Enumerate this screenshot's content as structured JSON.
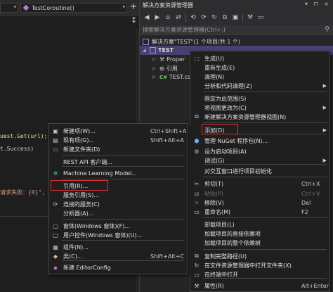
{
  "editor": {
    "nav_left": "",
    "nav_method": "TestCoroutine()",
    "add_glyph": "+",
    "split_glyph": "↕",
    "code_lines": [
      {
        "text": "uest.Get(url);",
        "color": "c-yellow"
      },
      {
        "text": "t.Success)",
        "color": "c-white"
      },
      {
        "text": "请求失败：{0}\", ...",
        "color": "c-red"
      }
    ]
  },
  "explorer": {
    "title": "解决方案资源管理器",
    "title_controls": "▾ ⊓ ×",
    "search_placeholder": "搜索解决方案资源管理器(Ctrl+;)",
    "tree": {
      "solution": "解决方案\"TEST\"(1 个项目/共 1 个)",
      "project": "TEST",
      "properties": "Proper",
      "references": "引用",
      "file": "TEST.cs"
    }
  },
  "left_menu": {
    "items": [
      {
        "label": "新建项(W)...",
        "shortcut": "Ctrl+Shift+A",
        "icon": "new-item-icon",
        "glyph": "▣",
        "color": "#c5c5c5"
      },
      {
        "label": "现有项(G)...",
        "shortcut": "Shift+Alt+A",
        "icon": "existing-item-icon",
        "glyph": "▤",
        "color": "#c5c5c5"
      },
      {
        "label": "新建文件夹(D)",
        "shortcut": "",
        "icon": "new-folder-icon",
        "glyph": "▭",
        "color": "#dcb67a"
      },
      {
        "label": "REST API 客户端...",
        "shortcut": "",
        "icon": "",
        "glyph": "",
        "color": ""
      },
      {
        "label": "Machine Learning Model...",
        "shortcut": "",
        "icon": "ml-model-icon",
        "glyph": "✲",
        "color": "#4ec9b0"
      },
      {
        "label": "引用(R)...",
        "shortcut": "",
        "icon": "",
        "glyph": "",
        "color": ""
      },
      {
        "label": "服务引用(S)...",
        "shortcut": "",
        "icon": "",
        "glyph": "",
        "color": ""
      },
      {
        "label": "连接的服务(C)",
        "shortcut": "",
        "icon": "connected-service-icon",
        "glyph": "⟳",
        "color": "#c5c5c5"
      },
      {
        "label": "分析器(A)...",
        "shortcut": "",
        "icon": "",
        "glyph": "",
        "color": ""
      },
      {
        "label": "窗体(Windows 窗体)(F)...",
        "shortcut": "",
        "icon": "form-icon",
        "glyph": "▢",
        "color": "#c5c5c5"
      },
      {
        "label": "用户控件(Windows 窗体)(U)...",
        "shortcut": "",
        "icon": "user-control-icon",
        "glyph": "▢",
        "color": "#c5c5c5"
      },
      {
        "label": "组件(N)...",
        "shortcut": "",
        "icon": "component-icon",
        "glyph": "▦",
        "color": "#c5c5c5"
      },
      {
        "label": "类(C)...",
        "shortcut": "Shift+Alt+C",
        "icon": "class-icon",
        "glyph": "◆",
        "color": "#dcb67a"
      },
      {
        "label": "新建 EditorConfig",
        "shortcut": "",
        "icon": "editorconfig-icon",
        "glyph": "▪",
        "color": "#b180d7"
      }
    ]
  },
  "right_menu": {
    "items": [
      {
        "label": "生成(U)",
        "shortcut": "",
        "icon": "build-icon",
        "glyph": "⬚",
        "color": "#c5c5c5",
        "submenu": false,
        "disabled": false
      },
      {
        "label": "重新生成(E)",
        "shortcut": "",
        "icon": "",
        "glyph": "",
        "color": "",
        "submenu": false,
        "disabled": false
      },
      {
        "label": "清理(N)",
        "shortcut": "",
        "icon": "",
        "glyph": "",
        "color": "",
        "submenu": false,
        "disabled": false
      },
      {
        "label": "分析和代码清理(Z)",
        "shortcut": "",
        "icon": "",
        "glyph": "",
        "color": "",
        "submenu": true,
        "disabled": false
      },
      {
        "label": "限定为此范围(S)",
        "shortcut": "",
        "icon": "",
        "glyph": "",
        "color": "",
        "submenu": false,
        "disabled": false
      },
      {
        "label": "将视图更改为(C)",
        "shortcut": "",
        "icon": "",
        "glyph": "",
        "color": "",
        "submenu": true,
        "disabled": false
      },
      {
        "label": "新建解决方案资源管理器视图(N)",
        "shortcut": "",
        "icon": "new-view-icon",
        "glyph": "⧉",
        "color": "#c5c5c5",
        "submenu": false,
        "disabled": false
      },
      {
        "label": "添加(D)",
        "shortcut": "",
        "icon": "",
        "glyph": "",
        "color": "",
        "submenu": true,
        "disabled": false
      },
      {
        "label": "管理 NuGet 程序包(N)...",
        "shortcut": "",
        "icon": "nuget-icon",
        "glyph": "⬢",
        "color": "#6fb0e8",
        "submenu": false,
        "disabled": false
      },
      {
        "label": "设为启动项目(A)",
        "shortcut": "",
        "icon": "gear-icon",
        "glyph": "⚙",
        "color": "#c5c5c5",
        "submenu": false,
        "disabled": false
      },
      {
        "label": "调试(G)",
        "shortcut": "",
        "icon": "",
        "glyph": "",
        "color": "",
        "submenu": true,
        "disabled": false
      },
      {
        "label": "对交互窗口进行项目初始化",
        "shortcut": "",
        "icon": "",
        "glyph": "",
        "color": "",
        "submenu": false,
        "disabled": false
      },
      {
        "label": "剪切(T)",
        "shortcut": "Ctrl+X",
        "icon": "cut-icon",
        "glyph": "✂",
        "color": "#c5c5c5",
        "submenu": false,
        "disabled": false
      },
      {
        "label": "粘贴(P)",
        "shortcut": "Ctrl+V",
        "icon": "paste-icon",
        "glyph": "▤",
        "color": "#6e6e6e",
        "submenu": false,
        "disabled": true
      },
      {
        "label": "移除(V)",
        "shortcut": "Del",
        "icon": "remove-icon",
        "glyph": "✕",
        "color": "#e04545",
        "submenu": false,
        "disabled": false
      },
      {
        "label": "重命名(M)",
        "shortcut": "F2",
        "icon": "rename-icon",
        "glyph": "▭",
        "color": "#c5c5c5",
        "submenu": false,
        "disabled": false
      },
      {
        "label": "卸载项目(L)",
        "shortcut": "",
        "icon": "",
        "glyph": "",
        "color": "",
        "submenu": false,
        "disabled": false
      },
      {
        "label": "加载项目的直接依赖项",
        "shortcut": "",
        "icon": "",
        "glyph": "",
        "color": "",
        "submenu": false,
        "disabled": false
      },
      {
        "label": "加载项目的整个依赖树",
        "shortcut": "",
        "icon": "",
        "glyph": "",
        "color": "",
        "submenu": false,
        "disabled": false
      },
      {
        "label": "复制完整路径(U)",
        "shortcut": "",
        "icon": "copy-path-icon",
        "glyph": "⧉",
        "color": "#c5c5c5",
        "submenu": false,
        "disabled": false
      },
      {
        "label": "在文件资源管理器中打开文件夹(X)",
        "shortcut": "",
        "icon": "open-folder-icon",
        "glyph": "↻",
        "color": "#c5c5c5",
        "submenu": false,
        "disabled": false
      },
      {
        "label": "在终端中打开",
        "shortcut": "",
        "icon": "terminal-icon",
        "glyph": "▭",
        "color": "#c5c5c5",
        "submenu": false,
        "disabled": false
      },
      {
        "label": "属性(R)",
        "shortcut": "Alt+Enter",
        "icon": "wrench-icon",
        "glyph": "⚒",
        "color": "#c5c5c5",
        "submenu": false,
        "disabled": false
      }
    ]
  },
  "colors": {
    "selection": "#4b3f72",
    "highlight_box": "#e03030",
    "menu_bg": "#1f1f1f"
  }
}
